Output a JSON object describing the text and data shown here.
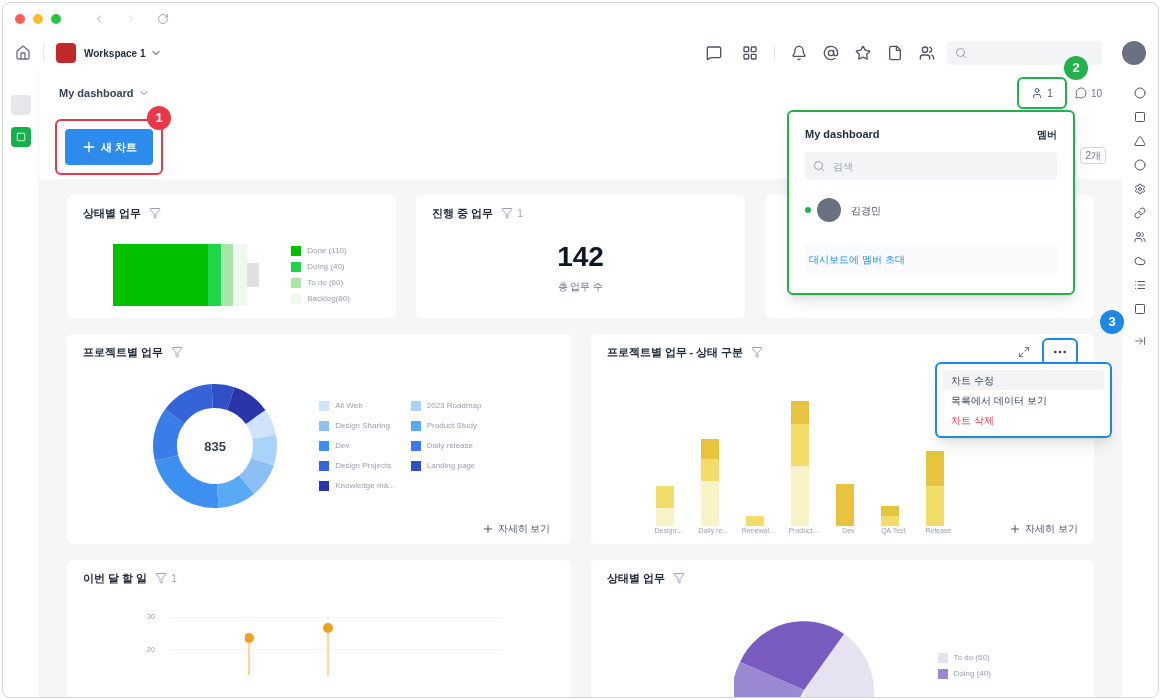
{
  "topbar": {
    "workspace": "Workspace 1"
  },
  "header": {
    "title": "My dashboard",
    "members_count": "1",
    "comments_count": "10",
    "extra_button": "2개"
  },
  "new_chart_button": {
    "label": "새 차트"
  },
  "annotations": [
    {
      "label": "1",
      "color": "#e8394b"
    },
    {
      "label": "2",
      "color": "#22b14c"
    },
    {
      "label": "3",
      "color": "#1e88e5"
    }
  ],
  "cards": [
    {
      "kind": "battery",
      "title": "상태별 업무",
      "legend": [
        {
          "label": "Done (110)",
          "color": "#00c000"
        },
        {
          "label": "Doing (40)",
          "color": "#1fd64a"
        },
        {
          "label": "To do (60)",
          "color": "#a8e6a8"
        },
        {
          "label": "Backlog(80)",
          "color": "#eef8ee"
        }
      ]
    },
    {
      "kind": "number",
      "title": "진행 중 업무",
      "filter_count": "1",
      "value": "142",
      "caption": "총 업무 수"
    },
    {
      "kind": "donut",
      "title": "프로젝트별 업무",
      "total": "835",
      "more": "자세히 보기",
      "legend": [
        {
          "label": "All Web",
          "color": "#cfe3fb"
        },
        {
          "label": "2023 Roadmap",
          "color": "#a9d3fb"
        },
        {
          "label": "Design Sharing",
          "color": "#8cc0f5"
        },
        {
          "label": "Product Study",
          "color": "#5aa9f5"
        },
        {
          "label": "Dev",
          "color": "#3d8ff0"
        },
        {
          "label": "Daily release",
          "color": "#3a7de8"
        },
        {
          "label": "Design Projects",
          "color": "#3563d8"
        },
        {
          "label": "Landing page",
          "color": "#3050c8"
        },
        {
          "label": "Knowledge ma...",
          "color": "#2a35a8"
        }
      ]
    },
    {
      "kind": "bar",
      "title": "프로젝트별 업무 - 상태 구분",
      "more": "자세히 보기",
      "categories": [
        "Design...",
        "Daily re...",
        "Renewal...",
        "Product...",
        "Dev",
        "QA Test",
        "Release"
      ]
    },
    {
      "kind": "lollipop",
      "title": "이번 달 할 일",
      "filter_count": "1",
      "ticks": [
        "30",
        "20"
      ]
    },
    {
      "kind": "pie",
      "title": "상태별 업무",
      "legend": [
        {
          "label": "To do (60)",
          "color": "#e6e2f2"
        },
        {
          "label": "Doing (40)",
          "color": "#9b88d3"
        }
      ]
    }
  ],
  "members_popover": {
    "title": "My dashboard",
    "tab": "멤버",
    "search_placeholder": "검색",
    "members": [
      {
        "name": "김경민",
        "online": true
      }
    ],
    "invite_link": "대시보드에 멤버 초대"
  },
  "chart_menu": {
    "items": [
      {
        "label": "차트 수정",
        "kind": "normal",
        "selected": true
      },
      {
        "label": "목록에서 데이터 보기",
        "kind": "normal",
        "selected": false
      },
      {
        "label": "차트 삭제",
        "kind": "danger",
        "selected": false
      }
    ]
  }
}
